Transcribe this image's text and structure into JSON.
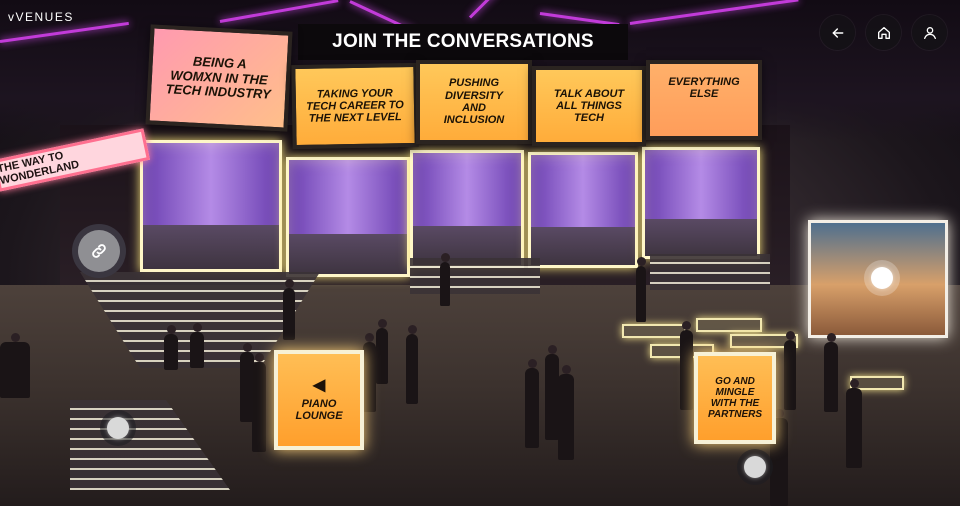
{
  "brand": {
    "logo_text": "vVENUES"
  },
  "header": {
    "title": "JOIN THE CONVERSATIONS"
  },
  "signs": [
    {
      "text": "BEING A WOMXN IN THE TECH INDUSTRY"
    },
    {
      "text": "TAKING YOUR TECH CAREER TO THE NEXT LEVEL"
    },
    {
      "text": "PUSHING DIVERSITY AND INCLUSION"
    },
    {
      "text": "TALK ABOUT ALL THINGS TECH"
    },
    {
      "text": "EVERYTHING ELSE"
    }
  ],
  "wonderland_sign": {
    "text": "THE WAY TO WONDERLAND"
  },
  "kiosks": {
    "piano": {
      "text": "PIANO LOUNGE",
      "arrow": "◀"
    },
    "partners": {
      "text": "GO AND MINGLE WITH THE PARTNERS"
    }
  },
  "nav": {
    "back_icon": "arrow-left-icon",
    "home_icon": "home-icon",
    "profile_icon": "user-icon"
  },
  "colors": {
    "neon_purple": "#c23bd9",
    "sign_orange": "#ffb845",
    "sign_pink": "#ff9ab0",
    "room_glow": "#fff7c8"
  }
}
